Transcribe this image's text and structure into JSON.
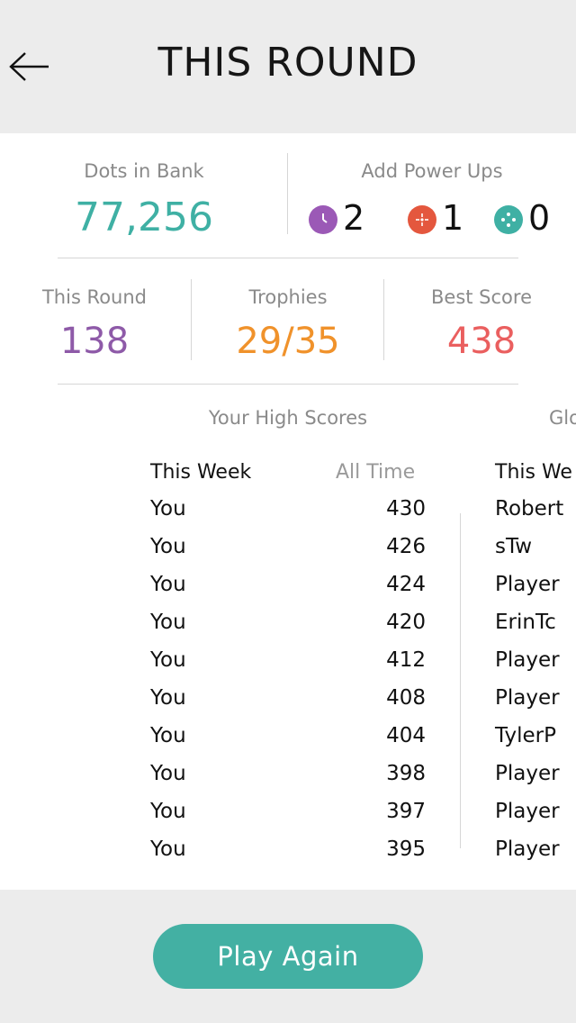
{
  "header": {
    "title": "THIS ROUND"
  },
  "bank": {
    "label": "Dots in Bank",
    "value": "77,256"
  },
  "power_ups": {
    "label": "Add Power Ups",
    "items": [
      {
        "icon": "clock-icon",
        "count": "2",
        "color": "#9b59b6"
      },
      {
        "icon": "expander-icon",
        "count": "1",
        "color": "#e4573e"
      },
      {
        "icon": "shrinker-icon",
        "count": "0",
        "color": "#3fb0a4"
      }
    ]
  },
  "stats": {
    "this_round": {
      "label": "This Round",
      "value": "138",
      "color": "#8e5aa8"
    },
    "trophies": {
      "label": "Trophies",
      "value": "29/35",
      "color": "#f0922b"
    },
    "best_score": {
      "label": "Best Score",
      "value": "438",
      "color": "#ea5f5f"
    }
  },
  "high_scores": {
    "title": "Your High Scores",
    "tabs": [
      "This Week",
      "All Time"
    ],
    "rows": [
      {
        "name": "You",
        "score": "430"
      },
      {
        "name": "You",
        "score": "426"
      },
      {
        "name": "You",
        "score": "424"
      },
      {
        "name": "You",
        "score": "420"
      },
      {
        "name": "You",
        "score": "412"
      },
      {
        "name": "You",
        "score": "408"
      },
      {
        "name": "You",
        "score": "404"
      },
      {
        "name": "You",
        "score": "398"
      },
      {
        "name": "You",
        "score": "397"
      },
      {
        "name": "You",
        "score": "395"
      }
    ]
  },
  "global_scores": {
    "title": "Glo",
    "tab": "This We",
    "names": [
      "Robert",
      "sTw",
      "Player",
      "ErinTc",
      "Player",
      "Player",
      "TylerP",
      "Player",
      "Player",
      "Player"
    ]
  },
  "footer": {
    "play_again": "Play Again"
  },
  "colors": {
    "accent": "#43b0a3",
    "bank_value": "#3fb0a4"
  }
}
